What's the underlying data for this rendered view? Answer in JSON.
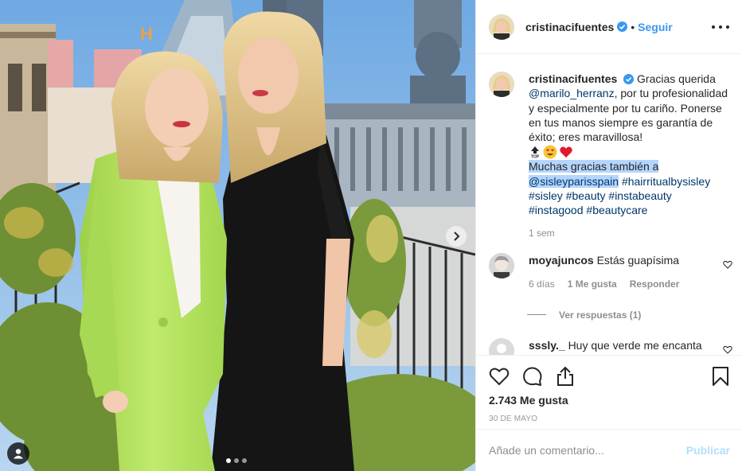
{
  "post": {
    "author": "cristinacifuentes",
    "follow_label": "Seguir",
    "separator": "•",
    "caption": {
      "user": "cristinacifuentes",
      "t1": "Gracias querida",
      "mention1": "@marilo_herranz",
      "t2": ", por tu profesionalidad y especialmente por tu cariño. Ponerse en tus manos siempre es garantía de éxito; eres maravillosa!",
      "emojis": [
        "top-icon",
        "heart-eyes-icon",
        "red-heart-icon"
      ],
      "sel1": "Muchas gracias también a",
      "sel2": "@sisleyparisspain",
      "tag1": "#hairritualbysisley",
      "tag2": "#sisley",
      "tag3": "#beauty",
      "tag4": "#instabeauty",
      "tag5": "#instagood",
      "tag6": "#beautycare",
      "time": "1 sem"
    },
    "comments": [
      {
        "user": "moyajuncos",
        "text": "Estás guapísima",
        "time": "6 días",
        "likes": "1 Me gusta",
        "reply": "Responder",
        "view_replies": "Ver respuestas (1)"
      },
      {
        "user": "sssly._",
        "text": "Huy que verde me encanta"
      }
    ],
    "likes": "2.743 Me gusta",
    "date": "30 DE MAYO",
    "comment_placeholder": "Añade un comentario...",
    "publish_label": "Publicar",
    "carousel": {
      "count": 3,
      "active": 1
    }
  },
  "colors": {
    "link": "#3897f0",
    "hashtag": "#003569",
    "selection": "#b4d5fe",
    "suit": "#b5e35e",
    "dress": "#1a1a1a",
    "sky": "#7fb3e6"
  }
}
